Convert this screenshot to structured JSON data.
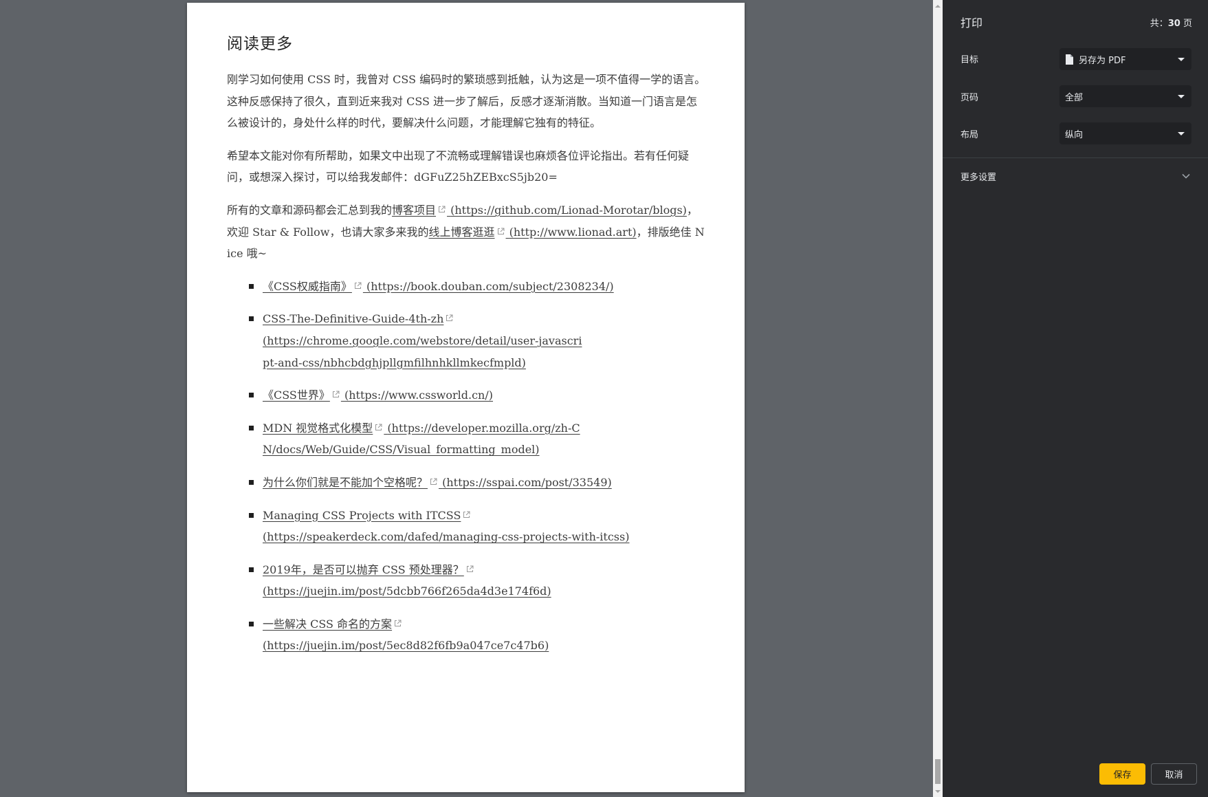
{
  "document": {
    "heading": "阅读更多",
    "para1": "刚学习如何使用 CSS 时，我曾对 CSS 编码时的繁琐感到抵触，认为这是一项不值得一学的语言。这种反感保持了很久，直到近来我对 CSS 进一步了解后，反感才逐渐消散。当知道一门语言是怎么被设计的，身处什么样的时代，要解决什么问题，才能理解它独有的特征。",
    "para2": "希望本文能对你有所帮助，如果文中出现了不流畅或理解错误也麻烦各位评论指出。若有任何疑问，或想深入探讨，可以给我发邮件：dGFuZ25hZEBxcS5jb20=",
    "para3": {
      "before": "所有的文章和源码都会汇总到我的",
      "link1_text": "博客项目",
      "link1_href": "(https://github.com/Lionad-Morotar/blogs)",
      "middle": "，欢迎 Star & Follow，也请大家多来我的",
      "link2_text": "线上博客逛逛",
      "link2_href": "(http://www.lionad.art)",
      "after": "，排版绝佳 Nice 哦~"
    },
    "references": [
      {
        "text": "《CSS权威指南》",
        "href": "(https://book.douban.com/subject/2308234/)"
      },
      {
        "text": "CSS-The-Definitive-Guide-4th-zh",
        "href": "(https://chrome.google.com/webstore/detail/user-javascript-and-css/nbhcbdghjpllgmfilhnhkllmkecfmpld)"
      },
      {
        "text": "《CSS世界》",
        "href": "(https://www.cssworld.cn/)"
      },
      {
        "text": "MDN 视觉格式化模型",
        "href": "(https://developer.mozilla.org/zh-CN/docs/Web/Guide/CSS/Visual_formatting_model)"
      },
      {
        "text": "为什么你们就是不能加个空格呢？",
        "href": "(https://sspai.com/post/33549)"
      },
      {
        "text": "Managing CSS Projects with ITCSS",
        "href": "(https://speakerdeck.com/dafed/managing-css-projects-with-itcss)"
      },
      {
        "text": "2019年，是否可以抛弃 CSS 预处理器？",
        "href": "(https://juejin.im/post/5dcbb766f265da4d3e174f6d)"
      },
      {
        "text": "一些解决 CSS 命名的方案",
        "href": "(https://juejin.im/post/5ec8d82f6fb9a047ce7c47b6)"
      }
    ]
  },
  "print_panel": {
    "title": "打印",
    "sheet_count_prefix": "共：",
    "sheet_count": "30",
    "sheet_count_suffix": " 页",
    "destination": {
      "label": "目标",
      "value": "另存为 PDF",
      "icon": "file-icon"
    },
    "pages": {
      "label": "页码",
      "value": "全部"
    },
    "layout": {
      "label": "布局",
      "value": "纵向"
    },
    "more_settings": {
      "label": "更多设置",
      "icon": "chevron-down-icon"
    },
    "save_button": "保存",
    "cancel_button": "取消",
    "accent_color": "#fbbc04",
    "panel_bg": "#292a2d"
  }
}
